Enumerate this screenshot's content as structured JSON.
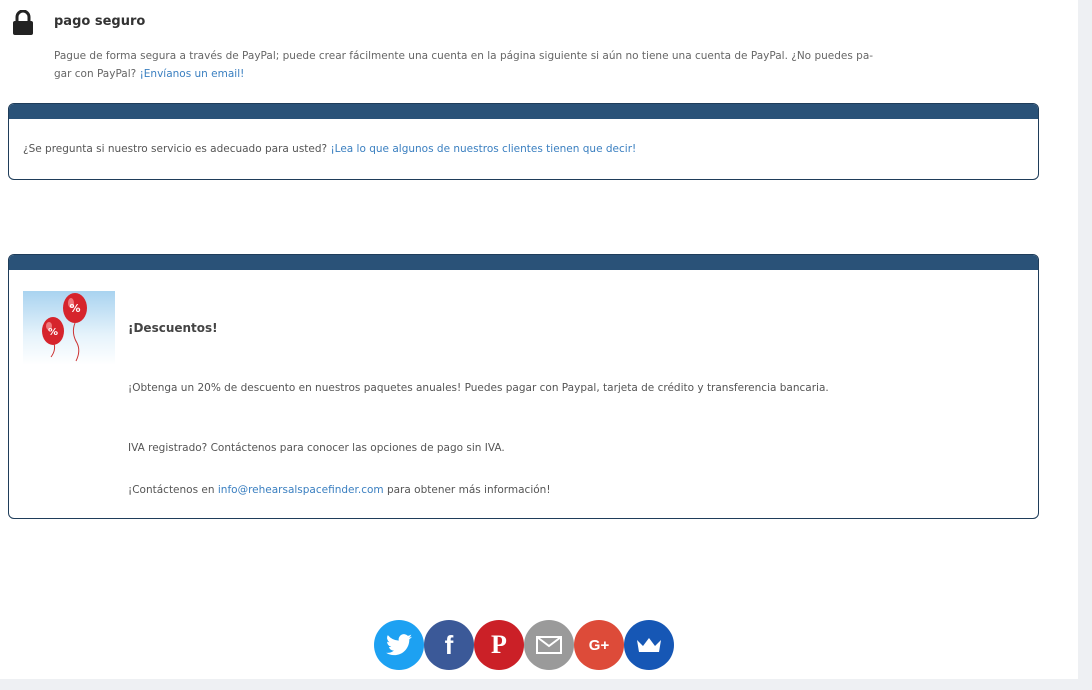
{
  "secure_payment": {
    "title": "pago seguro",
    "text": "Pague de forma segura a través de PayPal; puede crear fácilmente una cuenta en la página siguiente si aún no tiene una cuenta de PayPal. ¿No puedes pa-gar con PayPal?",
    "text_part1": "Pague de forma segura a través de PayPal; puede crear fácilmente una cuenta en la página siguiente si aún no tiene una cuenta de PayPal. ¿No puedes pa-",
    "text_part2": "gar con PayPal? ",
    "email_link": "¡Envíanos un email!"
  },
  "testimonial_panel": {
    "question": "¿Se pregunta si nuestro servicio es adecuado para usted? ",
    "link": "¡Lea lo que algunos de nuestros clientes tienen que decir!"
  },
  "discount_panel": {
    "title": "¡Descuentos!",
    "line1": "¡Obtenga un 20% de descuento en nuestros paquetes anuales! Puedes pagar con Paypal, tarjeta de crédito y transferencia bancaria.",
    "line2": "IVA registrado? Contáctenos para conocer las opciones de pago sin IVA.",
    "line3_prefix": "¡Contáctenos en ",
    "line3_email": "info@rehearsalspacefinder.com",
    "line3_suffix": " para obtener más información!",
    "balloon_symbol": "%"
  },
  "social": [
    {
      "name": "twitter",
      "color": "#1da1f2",
      "icon": "twitter-icon"
    },
    {
      "name": "facebook",
      "color": "#3b5998",
      "icon": "facebook-icon",
      "glyph": "f"
    },
    {
      "name": "pinterest",
      "color": "#cb2027",
      "icon": "pinterest-icon",
      "glyph": "P"
    },
    {
      "name": "email",
      "color": "#9a9a9a",
      "icon": "envelope-icon"
    },
    {
      "name": "google-plus",
      "color": "#dd4b39",
      "icon": "google-plus-icon",
      "glyph": "G+"
    },
    {
      "name": "crown",
      "color": "#1657b5",
      "icon": "crown-icon"
    }
  ]
}
